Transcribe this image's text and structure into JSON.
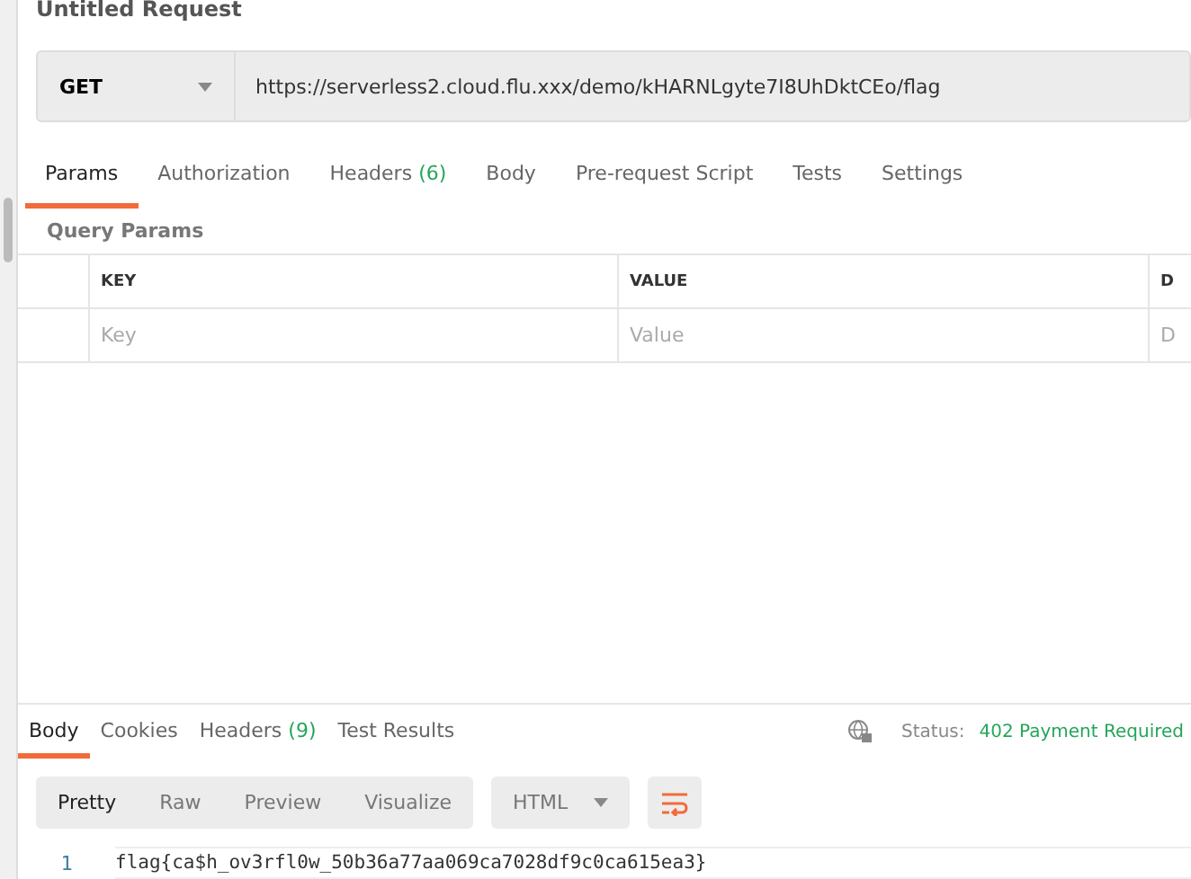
{
  "request": {
    "title": "Untitled Request",
    "method": "GET",
    "url": "https://serverless2.cloud.flu.xxx/demo/kHARNLgyte7I8UhDktCEo/flag"
  },
  "request_tabs": [
    {
      "label": "Params",
      "selected": true
    },
    {
      "label": "Authorization",
      "selected": false
    },
    {
      "label": "Headers",
      "count": "(6)",
      "selected": false
    },
    {
      "label": "Body",
      "selected": false
    },
    {
      "label": "Pre-request Script",
      "selected": false
    },
    {
      "label": "Tests",
      "selected": false
    },
    {
      "label": "Settings",
      "selected": false
    }
  ],
  "query_params": {
    "title": "Query Params",
    "columns": [
      "KEY",
      "VALUE",
      "D"
    ],
    "placeholders": [
      "Key",
      "Value",
      "D"
    ]
  },
  "response_tabs": [
    {
      "label": "Body",
      "selected": true
    },
    {
      "label": "Cookies",
      "selected": false
    },
    {
      "label": "Headers",
      "count": "(9)",
      "selected": false
    },
    {
      "label": "Test Results",
      "selected": false
    }
  ],
  "status": {
    "label": "Status:",
    "value": "402 Payment Required"
  },
  "view_modes": [
    {
      "label": "Pretty",
      "selected": true
    },
    {
      "label": "Raw",
      "selected": false
    },
    {
      "label": "Preview",
      "selected": false
    },
    {
      "label": "Visualize",
      "selected": false
    }
  ],
  "format": "HTML",
  "body_lines": [
    {
      "number": "1",
      "text": "flag{ca$h_ov3rfl0w_50b36a77aa069ca7028df9c0ca615ea3}"
    }
  ]
}
